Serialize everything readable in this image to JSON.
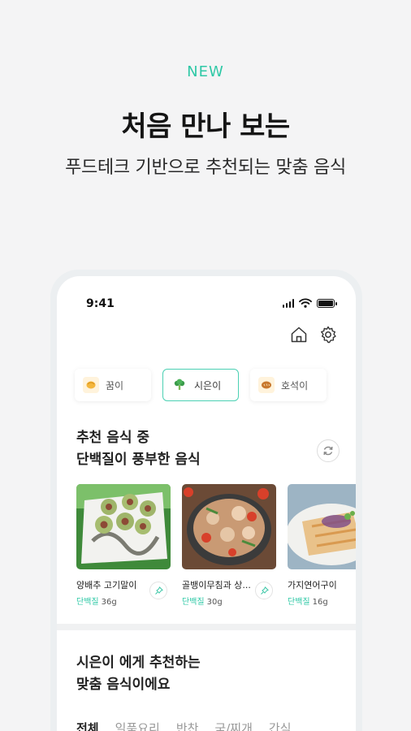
{
  "promo": {
    "badge": "NEW",
    "headline": "처음 만나 보는",
    "subline": "푸드테크 기반으로 추천되는 맞춤 음식"
  },
  "status": {
    "time": "9:41"
  },
  "kids": [
    {
      "name": "꿈이",
      "icon": "dumpling-icon"
    },
    {
      "name": "시은이",
      "icon": "broccoli-icon",
      "active": true
    },
    {
      "name": "호석이",
      "icon": "bread-icon"
    }
  ],
  "recommend": {
    "title_line1": "추천 음식 중",
    "title_line2": "단백질이 풍부한 음식"
  },
  "foods": [
    {
      "name": "양배추 고기말이",
      "nutrient": "단백질",
      "amount": "36g"
    },
    {
      "name": "골뱅이무침과 상...",
      "nutrient": "단백질",
      "amount": "30g"
    },
    {
      "name": "가지연어구이",
      "nutrient": "단백질",
      "amount": "16g"
    }
  ],
  "section2": {
    "line1": "시은이 에게 추천하는",
    "line2": "맞춤 음식이에요"
  },
  "tabs": [
    "전체",
    "일품요리",
    "반찬",
    "국/찌개",
    "간식"
  ],
  "colors": {
    "accent": "#2ec8a6"
  }
}
